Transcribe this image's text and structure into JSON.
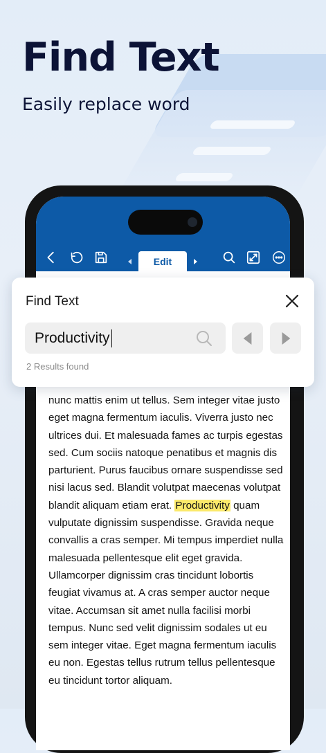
{
  "hero": {
    "title": "Find Text",
    "subtitle": "Easily replace word"
  },
  "toolbar": {
    "tab_label": "Edit",
    "icons": [
      "back-icon",
      "undo-icon",
      "save-icon",
      "search-icon",
      "expand-icon",
      "more-icon"
    ]
  },
  "find_panel": {
    "title": "Find Text",
    "search_value": "Productivity",
    "results_text": "2 Results found"
  },
  "document": {
    "before": "nunc mattis enim ut tellus. Sem integer vitae justo eget magna fermentum iaculis. Viverra justo nec ultrices dui. Et malesuada fames ac turpis egestas sed. Cum sociis natoque penatibus et magnis dis parturient. Purus faucibus ornare suspendisse sed nisi lacus sed. Blandit volutpat maecenas volutpat blandit aliquam etiam erat.",
    "highlight": "Productivity",
    "after": "quam vulputate dignissim suspendisse. Gravida neque convallis a cras semper. Mi tempus imperdiet nulla malesuada pellentesque elit eget gravida. Ullamcorper dignissim cras tincidunt lobortis feugiat vivamus at. A cras semper auctor neque vitae. Accumsan sit amet nulla facilisi morbi tempus. Nunc sed velit dignissim sodales ut eu sem integer vitae. Eget magna fermentum iaculis eu non. Egestas tellus rutrum tellus pellentesque eu tincidunt tortor aliquam."
  },
  "colors": {
    "toolbar": "#0d5aa7",
    "title_text": "#0c1336",
    "highlight": "#fbe96a",
    "background": "#e6eef8"
  }
}
